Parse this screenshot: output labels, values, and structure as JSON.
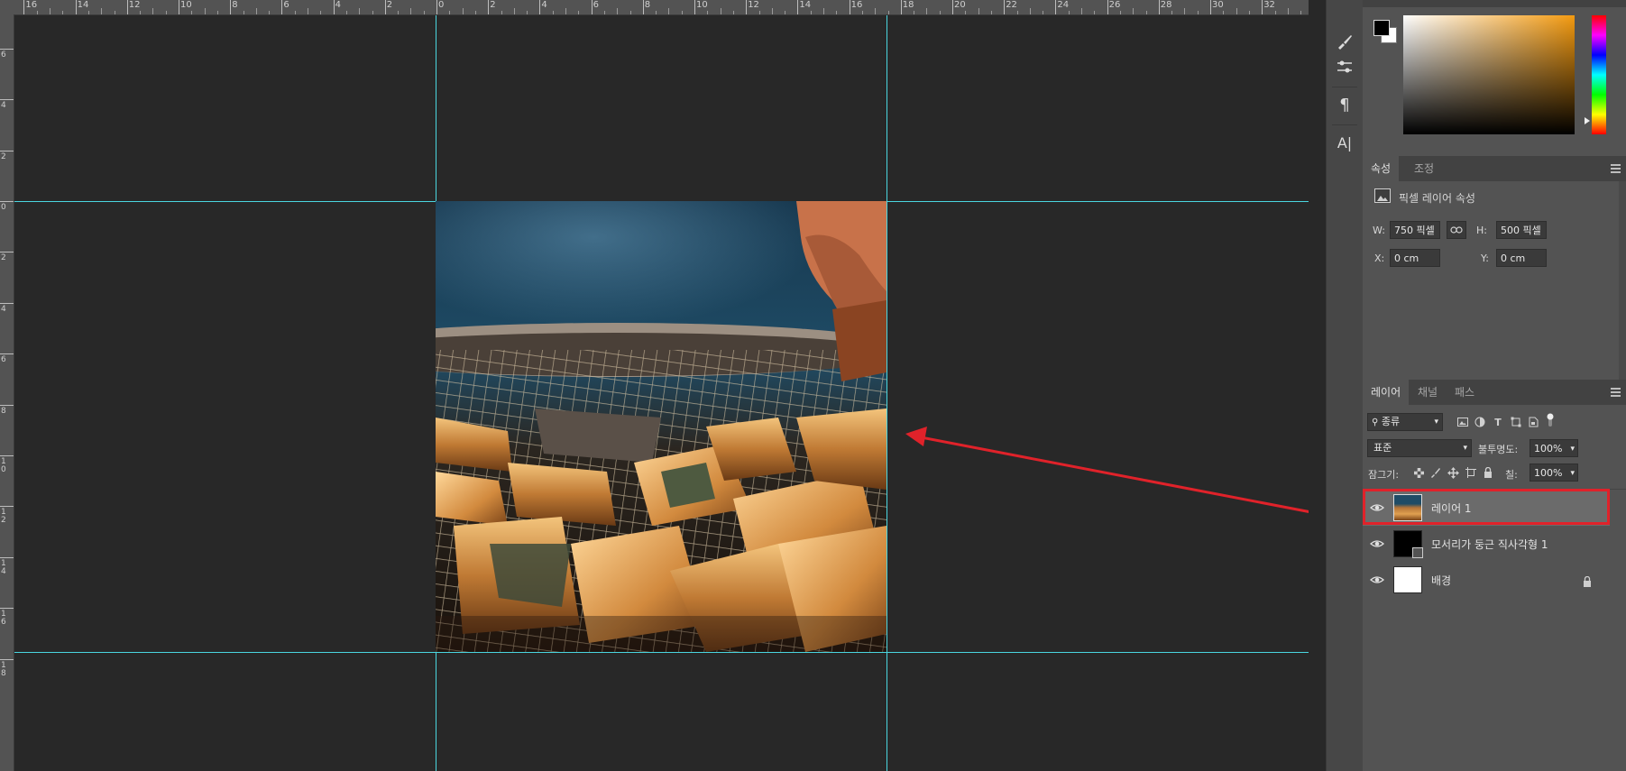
{
  "ruler": {
    "top_labels": [
      "16",
      "14",
      "12",
      "10",
      "8",
      "6",
      "4",
      "2",
      "0",
      "2",
      "4",
      "6",
      "8",
      "10",
      "12",
      "14",
      "16",
      "18",
      "20",
      "22",
      "24",
      "26",
      "28",
      "30",
      "32"
    ],
    "left_labels": [
      "6",
      "4",
      "2",
      "0",
      "2",
      "4",
      "6",
      "8",
      "10",
      "12",
      "14",
      "16",
      "18"
    ]
  },
  "tools": {
    "paragraph_glyph": "¶",
    "character_glyph": "A|"
  },
  "color_panel": {
    "foreground": "#000000",
    "background": "#ffffff"
  },
  "properties": {
    "tabs": [
      "속성",
      "조정"
    ],
    "header": "픽셀 레이어 속성",
    "w_label": "W:",
    "w_value": "750 픽셀",
    "h_label": "H:",
    "h_value": "500 픽셀",
    "x_label": "X:",
    "x_value": "0 cm",
    "y_label": "Y:",
    "y_value": "0 cm"
  },
  "layers_panel": {
    "tabs": [
      "레이어",
      "채널",
      "패스"
    ],
    "filter_value": "종류",
    "blend_mode": "표준",
    "opacity_label": "불투명도:",
    "opacity_value": "100%",
    "lock_label": "잠그기:",
    "fill_label": "칠:",
    "fill_value": "100%",
    "layers": [
      {
        "name": "레이어 1",
        "selected": true
      },
      {
        "name": "모서리가 둥근 직사각형 1",
        "selected": false
      },
      {
        "name": "배경",
        "selected": false,
        "locked": true
      }
    ]
  },
  "colors": {
    "guide": "#4ad6e0",
    "highlight": "#e0222a",
    "arrow": "#e0222a"
  }
}
